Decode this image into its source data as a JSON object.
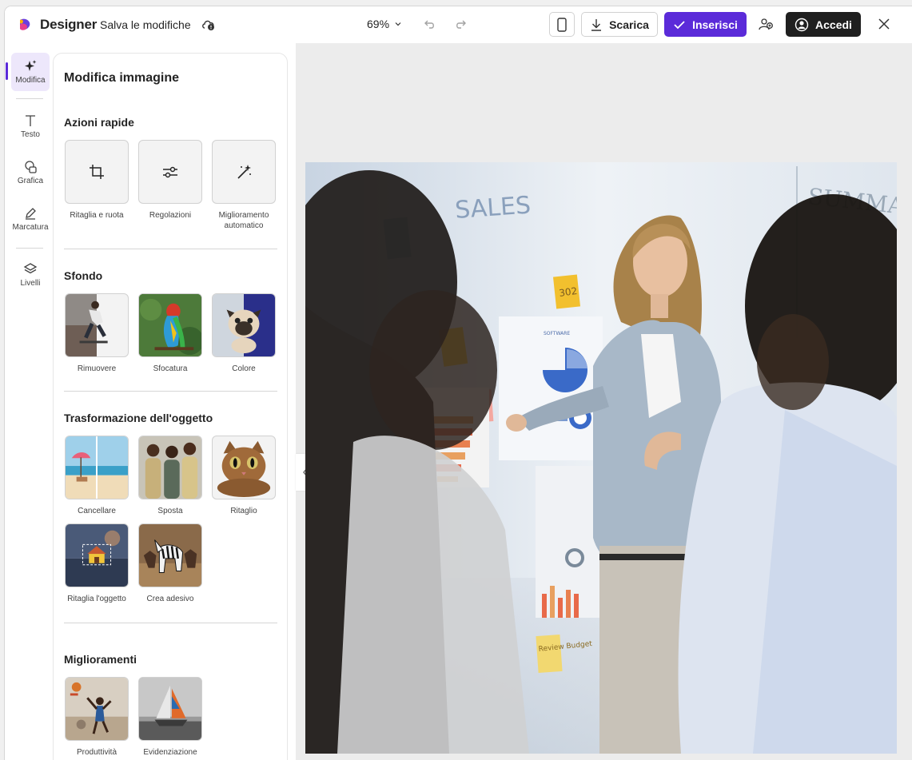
{
  "header": {
    "app_name": "Designer",
    "save_label": "Salva le modifiche",
    "zoom": "69%",
    "download_label": "Scarica",
    "insert_label": "Inserisci",
    "signin_label": "Accedi"
  },
  "rail": {
    "items": [
      {
        "label": "Modifica",
        "icon": "sparkle-icon"
      },
      {
        "label": "Testo",
        "icon": "text-icon"
      },
      {
        "label": "Grafica",
        "icon": "shapes-icon"
      },
      {
        "label": "Marcatura",
        "icon": "pen-icon"
      },
      {
        "label": "Livelli",
        "icon": "layers-icon"
      }
    ]
  },
  "panel": {
    "title": "Modifica immagine",
    "quick_actions": {
      "title": "Azioni rapide",
      "items": [
        "Ritaglia e ruota",
        "Regolazioni",
        "Miglioramento automatico"
      ]
    },
    "background": {
      "title": "Sfondo",
      "items": [
        "Rimuovere",
        "Sfocatura",
        "Colore"
      ]
    },
    "transform": {
      "title": "Trasformazione dell'oggetto",
      "items": [
        "Cancellare",
        "Sposta",
        "Ritaglio",
        "Ritaglia l'oggetto",
        "Crea adesivo"
      ]
    },
    "enhance": {
      "title": "Miglioramenti",
      "items": [
        "Produttività",
        "Evidenziazione"
      ]
    }
  },
  "canvas": {
    "whiteboard_texts": [
      "SALES",
      "SUMMARY",
      "302",
      "Review Budget"
    ]
  },
  "colors": {
    "accent": "#5b2bd9",
    "dark_button": "#1f1f1f",
    "canvas_bg": "#ececec"
  }
}
